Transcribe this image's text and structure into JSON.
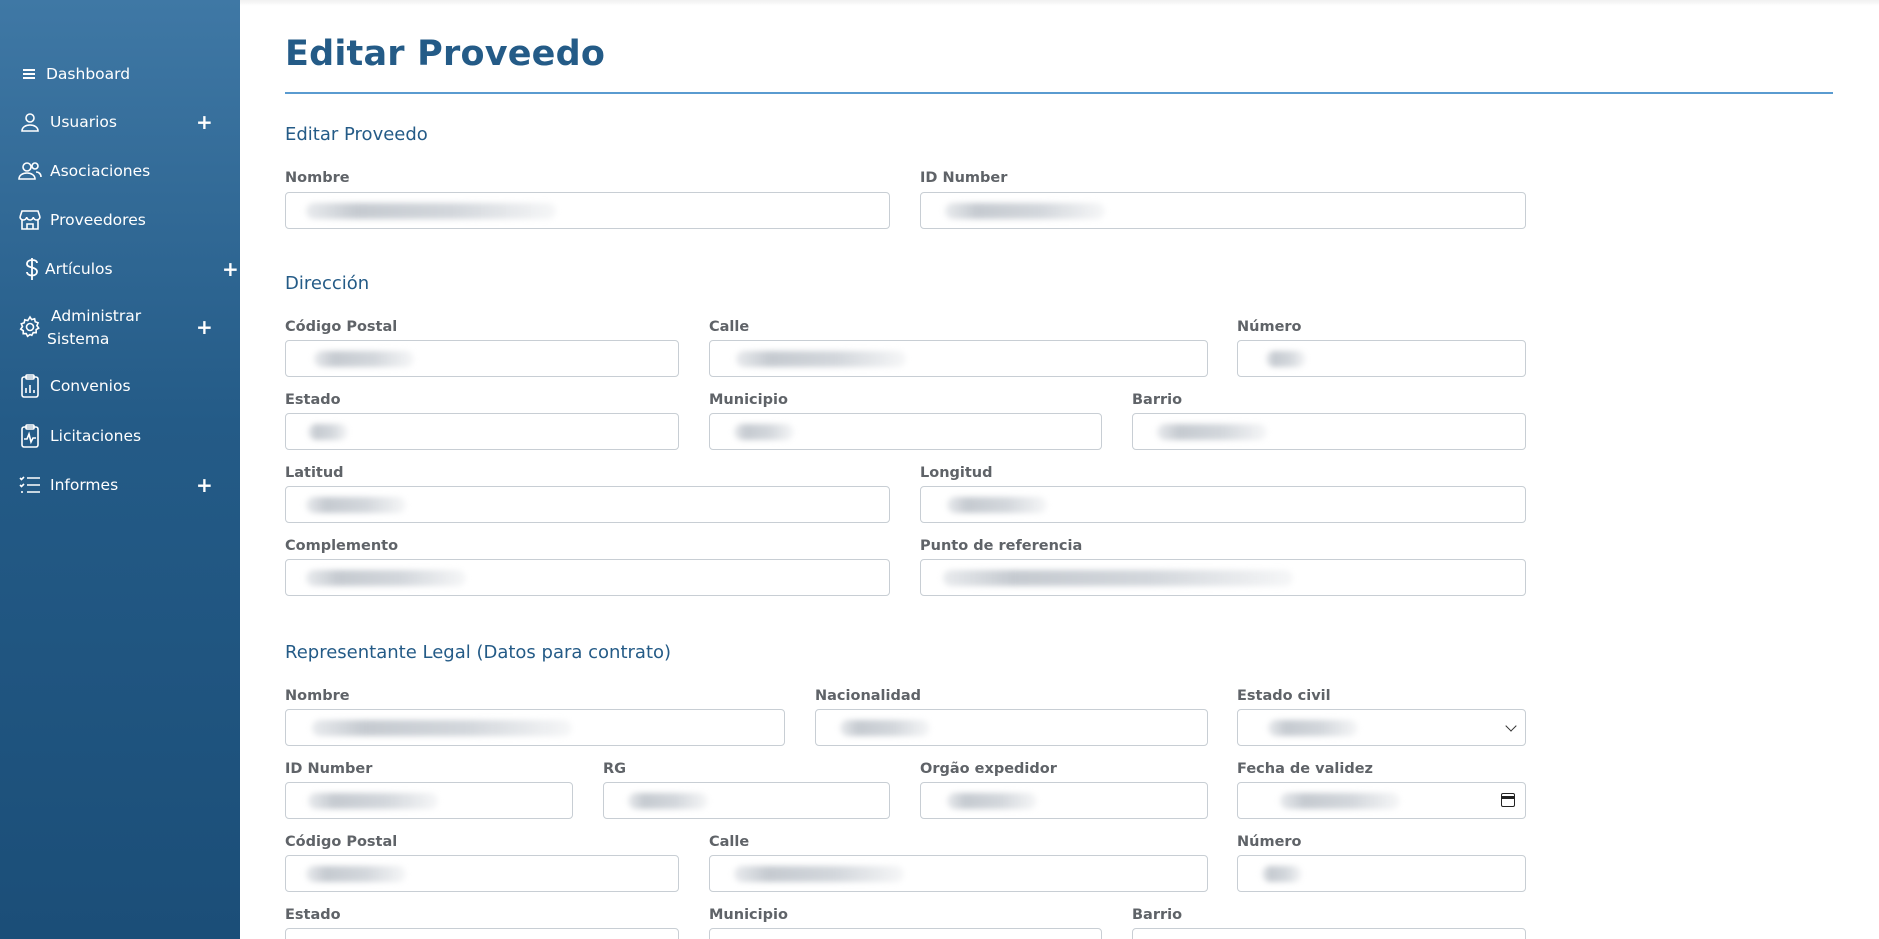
{
  "sidebar": {
    "items": [
      {
        "label": "Dashboard",
        "icon": "menu-icon"
      },
      {
        "label": "Usuarios",
        "icon": "user-icon"
      },
      {
        "label": "Asociaciones",
        "icon": "users-icon"
      },
      {
        "label": "Proveedores",
        "icon": "store-icon"
      },
      {
        "label": "Artículos",
        "icon": "dollar-icon"
      },
      {
        "label": "Administrar Sistema",
        "icon": "gear-icon"
      },
      {
        "label": "Convenios",
        "icon": "clipboard-chart-icon"
      },
      {
        "label": "Licitaciones",
        "icon": "clipboard-pulse-icon"
      },
      {
        "label": "Informes",
        "icon": "list-check-icon"
      }
    ],
    "expand_symbol": "+",
    "admin_line1": "Administrar",
    "admin_line2": "Sistema"
  },
  "page": {
    "title": "Editar Proveedo"
  },
  "sections": {
    "supplier": {
      "title": "Editar Proveedo",
      "nombre_label": "Nombre",
      "id_number_label": "ID Number"
    },
    "address": {
      "title": "Dirección",
      "codigo_postal_label": "Código Postal",
      "calle_label": "Calle",
      "numero_label": "Número",
      "estado_label": "Estado",
      "municipio_label": "Municipio",
      "barrio_label": "Barrio",
      "latitud_label": "Latitud",
      "longitud_label": "Longitud",
      "complemento_label": "Complemento",
      "punto_referencia_label": "Punto de referencia"
    },
    "legal_rep": {
      "title": "Representante Legal (Datos para contrato)",
      "nombre_label": "Nombre",
      "nacionalidad_label": "Nacionalidad",
      "estado_civil_label": "Estado civil",
      "id_number_label": "ID Number",
      "rg_label": "RG",
      "orgao_label": "Orgão expedidor",
      "fecha_validez_label": "Fecha de validez",
      "codigo_postal_label": "Código Postal",
      "calle_label": "Calle",
      "numero_label": "Número",
      "estado_label": "Estado",
      "municipio_label": "Municipio",
      "barrio_label": "Barrio"
    }
  },
  "colors": {
    "sidebar_top": "#3f78a5",
    "sidebar_bottom": "#1b4e78",
    "heading": "#245b87",
    "title_rule": "#5a9bd0"
  }
}
